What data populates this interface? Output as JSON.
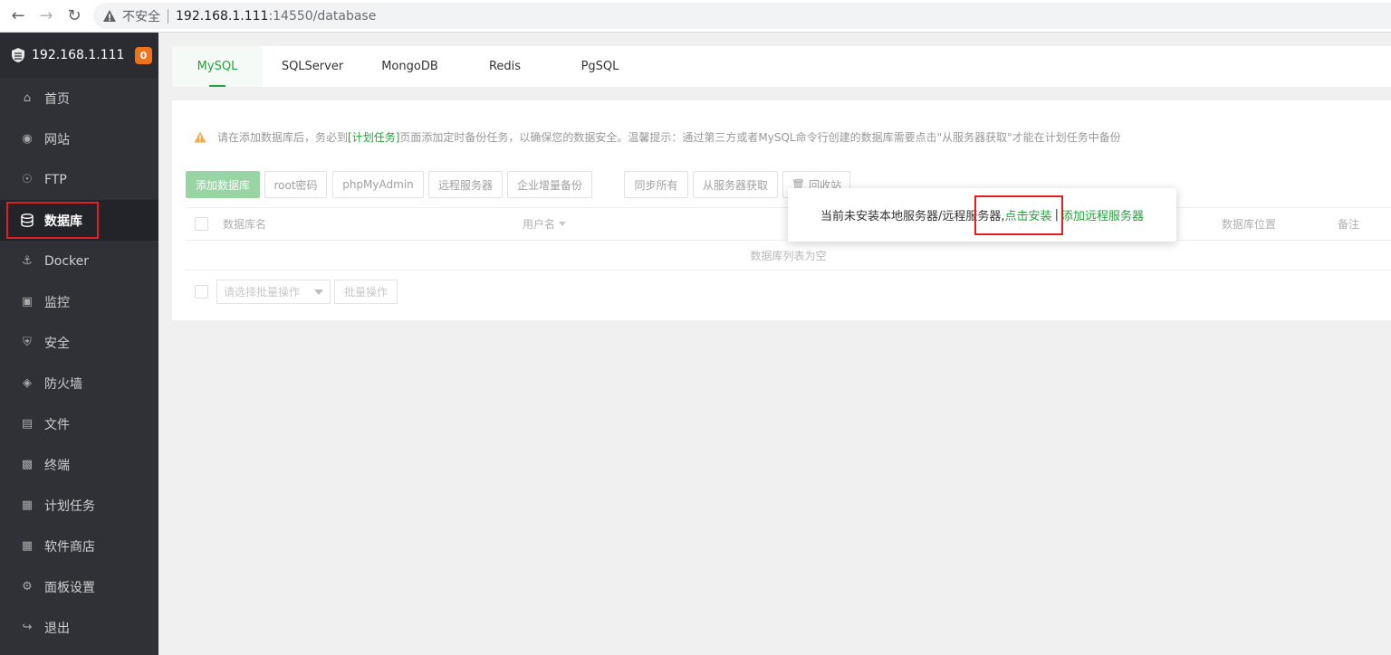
{
  "browser": {
    "insecure_label": "不安全",
    "url_host": "192.168.1.111",
    "url_rest": ":14550/database"
  },
  "sidebar": {
    "host": "192.168.1.111",
    "badge": "0",
    "active_color": "#20a53a",
    "items": [
      {
        "label": "首页",
        "icon": "home-icon"
      },
      {
        "label": "网站",
        "icon": "globe-icon"
      },
      {
        "label": "FTP",
        "icon": "ftp-icon"
      },
      {
        "label": "数据库",
        "icon": "database-icon"
      },
      {
        "label": "Docker",
        "icon": "docker-icon"
      },
      {
        "label": "监控",
        "icon": "monitor-icon"
      },
      {
        "label": "安全",
        "icon": "shield-icon"
      },
      {
        "label": "防火墙",
        "icon": "firewall-icon"
      },
      {
        "label": "文件",
        "icon": "folder-icon"
      },
      {
        "label": "终端",
        "icon": "terminal-icon"
      },
      {
        "label": "计划任务",
        "icon": "calendar-icon"
      },
      {
        "label": "软件商店",
        "icon": "apps-icon"
      },
      {
        "label": "面板设置",
        "icon": "gear-icon"
      },
      {
        "label": "退出",
        "icon": "logout-icon"
      }
    ]
  },
  "tabs": [
    "MySQL",
    "SQLServer",
    "MongoDB",
    "Redis",
    "PgSQL"
  ],
  "notice": {
    "part1": "请在添加数据库后，务必到",
    "link": "[计划任务]",
    "part2": "页面添加定时备份任务，以确保您的数据安全。温馨提示：通过第三方或者MySQL命令行创建的数据库需要点击\"从服务器获取\"才能在计划任务中备份"
  },
  "toolbar": {
    "add_db": "添加数据库",
    "root_pwd": "root密码",
    "phpmyadmin": "phpMyAdmin",
    "remote_server": "远程服务器",
    "enterprise_backup": "企业增量备份",
    "sync_all": "同步所有",
    "fetch_from_server": "从服务器获取",
    "recycle_bin": "回收站"
  },
  "table": {
    "col_name": "数据库名",
    "col_user": "用户名",
    "col_location": "数据库位置",
    "col_note": "备注",
    "empty": "数据库列表为空"
  },
  "batch": {
    "placeholder": "请选择批量操作",
    "button": "批量操作"
  },
  "popup": {
    "text": "当前未安装本地服务器/远程服务器,",
    "install": "点击安装",
    "separator": "|",
    "add_remote": "添加远程服务器"
  }
}
